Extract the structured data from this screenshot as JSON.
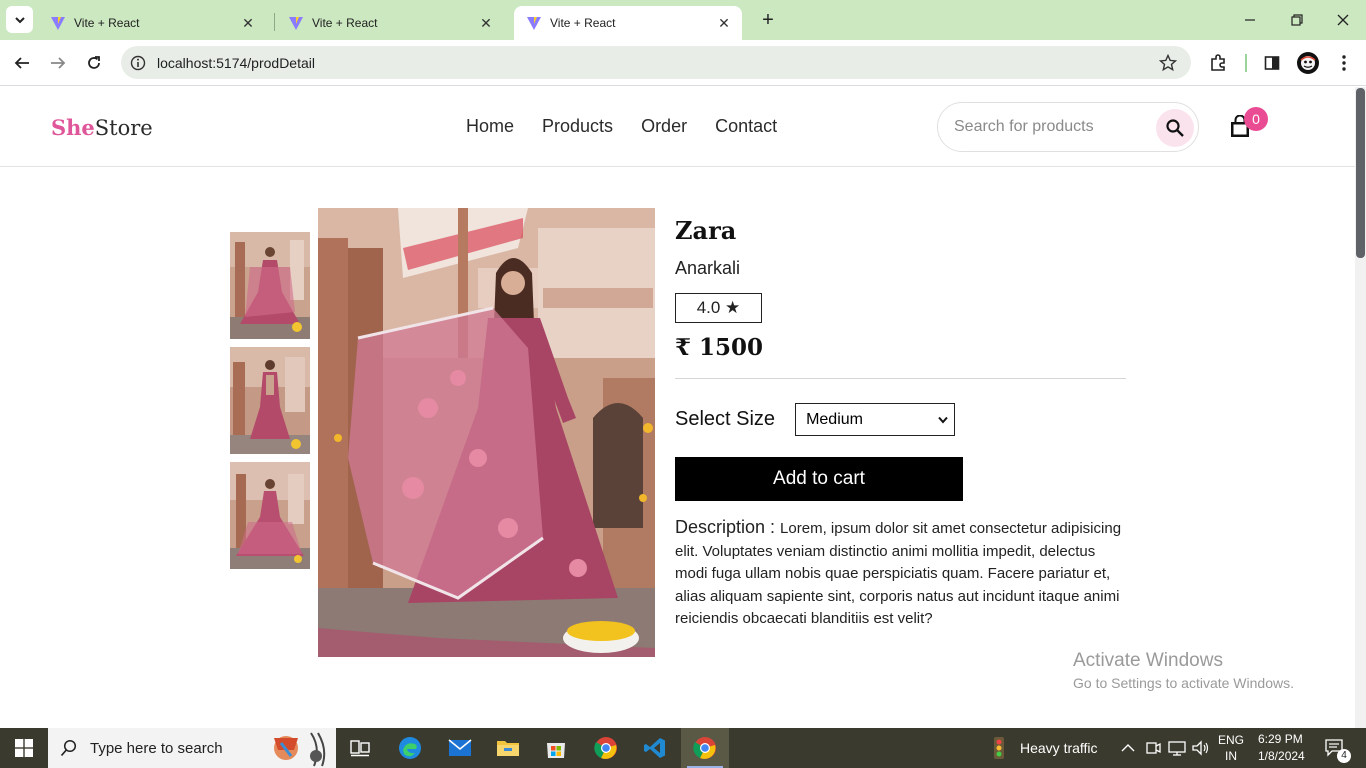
{
  "browser": {
    "tabs": [
      {
        "title": "Vite + React",
        "active": false
      },
      {
        "title": "Vite + React",
        "active": false
      },
      {
        "title": "Vite + React",
        "active": true
      }
    ],
    "url": "localhost:5174/prodDetail"
  },
  "site": {
    "logo_she": "She",
    "logo_store": "Store",
    "nav": [
      "Home",
      "Products",
      "Order",
      "Contact"
    ],
    "search_placeholder": "Search for products",
    "cart_count": "0"
  },
  "product": {
    "brand": "Zara",
    "name": "Anarkali",
    "rating": "4.0 ★",
    "price": "₹ 1500",
    "size_label": "Select Size",
    "size_selected": "Medium",
    "add_to_cart": "Add to cart",
    "description_label": "Description : ",
    "description": "Lorem, ipsum dolor sit amet consectetur adipisicing elit. Voluptates veniam distinctio animi mollitia impedit, delectus modi fuga ullam nobis quae perspiciatis quam. Facere pariatur et, alias aliquam sapiente sint, corporis natus aut incidunt itaque animi reiciendis obcaecati blanditiis est velit?"
  },
  "watermark": {
    "line1": "Activate Windows",
    "line2": "Go to Settings to activate Windows."
  },
  "taskbar": {
    "search_placeholder": "Type here to search",
    "weather": "Heavy traffic",
    "lang1": "ENG",
    "lang2": "IN",
    "time": "6:29 PM",
    "date": "1/8/2024",
    "notifications": "4"
  },
  "colors": {
    "accent_pink": "#e0569a",
    "badge_pink": "#ea4c94",
    "tab_strip": "#cbe8c0"
  }
}
